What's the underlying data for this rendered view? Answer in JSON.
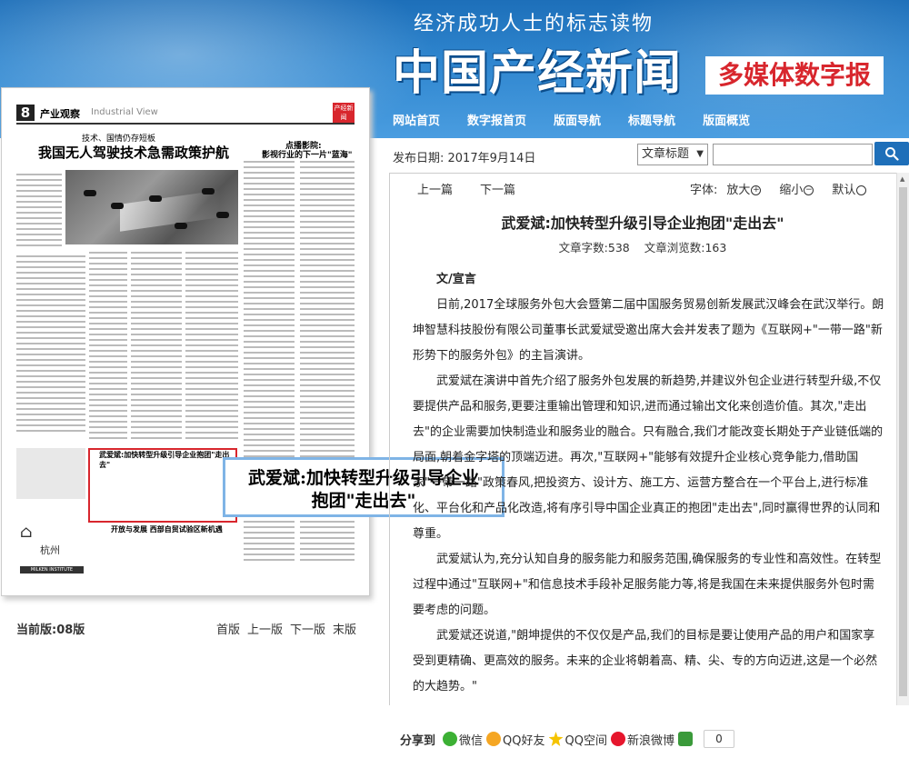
{
  "header": {
    "tagline": "经济成功人士的标志读物",
    "brand": "中国产经新闻",
    "brand_sub": "多媒体数字报",
    "nav": [
      "网站首页",
      "数字报首页",
      "版面导航",
      "标题导航",
      "版面概览"
    ]
  },
  "paper": {
    "page_number": "8",
    "section": "产业观察",
    "section_en": "Industrial View",
    "badge": "产经新闻",
    "kicker": "技术、国情仍存短板",
    "title": "我国无人驾驶技术急需政策护航",
    "side_title": "点播影院:",
    "side_sub": "影视行业的下一片\"蓝海\"",
    "redbox_title": "武爱斌:加快转型升级引导企业抱团\"走出去\"",
    "logo_text": "杭州",
    "milken": "MILKEN INSTITUTE",
    "bottom_title": "开放与发展 西部自贸试验区新机遇"
  },
  "callout": {
    "line1": "武爱斌:加快转型升级引导企业",
    "line2": "抱团\"走出去\""
  },
  "edition": {
    "current": "当前版:08版",
    "pager": [
      "首版",
      "上一版",
      "下一版",
      "末版"
    ]
  },
  "article": {
    "pubdate": "发布日期: 2017年9月14日",
    "search_select": "文章标题",
    "search_placeholder": "",
    "prev": "上一篇",
    "next": "下一篇",
    "font_label": "字体:",
    "font_bigger": "放大",
    "font_smaller": "缩小",
    "font_default": "默认",
    "title": "武爱斌:加快转型升级引导企业抱团\"走出去\"",
    "word_count": "文章字数:538",
    "views": "文章浏览数:163",
    "author": "文/宣言",
    "paragraphs": [
      "日前,2017全球服务外包大会暨第二届中国服务贸易创新发展武汉峰会在武汉举行。朗坤智慧科技股份有限公司董事长武爱斌受邀出席大会并发表了题为《互联网+\"一带一路\"新形势下的服务外包》的主旨演讲。",
      "武爱斌在演讲中首先介绍了服务外包发展的新趋势,并建议外包企业进行转型升级,不仅要提供产品和服务,更要注重输出管理和知识,进而通过输出文化来创造价值。其次,\"走出去\"的企业需要加快制造业和服务业的融合。只有融合,我们才能改变长期处于产业链低端的局面,朝着金字塔的顶端迈进。再次,\"互联网+\"能够有效提升企业核心竞争能力,借助国家\"一带一路\"政策春风,把投资方、设计方、施工方、运营方整合在一个平台上,进行标准化、平台化和产品化改造,将有序引导中国企业真正的抱团\"走出去\",同时赢得世界的认同和尊重。",
      "武爱斌认为,充分认知自身的服务能力和服务范围,确保服务的专业性和高效性。在转型过程中通过\"互联网+\"和信息技术手段补足服务能力等,将是我国在未来提供服务外包时需要考虑的问题。",
      "武爱斌还说道,\"朗坤提供的不仅仅是产品,我们的目标是要让使用产品的用户和国家享受到更精确、更高效的服务。未来的企业将朝着高、精、尖、专的方向迈进,这是一个必然的大趋势。\""
    ]
  },
  "share": {
    "label": "分享到",
    "items": [
      "微信",
      "QQ好友",
      "QQ空间",
      "新浪微博"
    ],
    "count": "0"
  },
  "colors": {
    "header_blue": "#2f86cf",
    "brand_red": "#d8262d",
    "search_button": "#1e6fb9",
    "callout_border": "#7fb4e6"
  }
}
